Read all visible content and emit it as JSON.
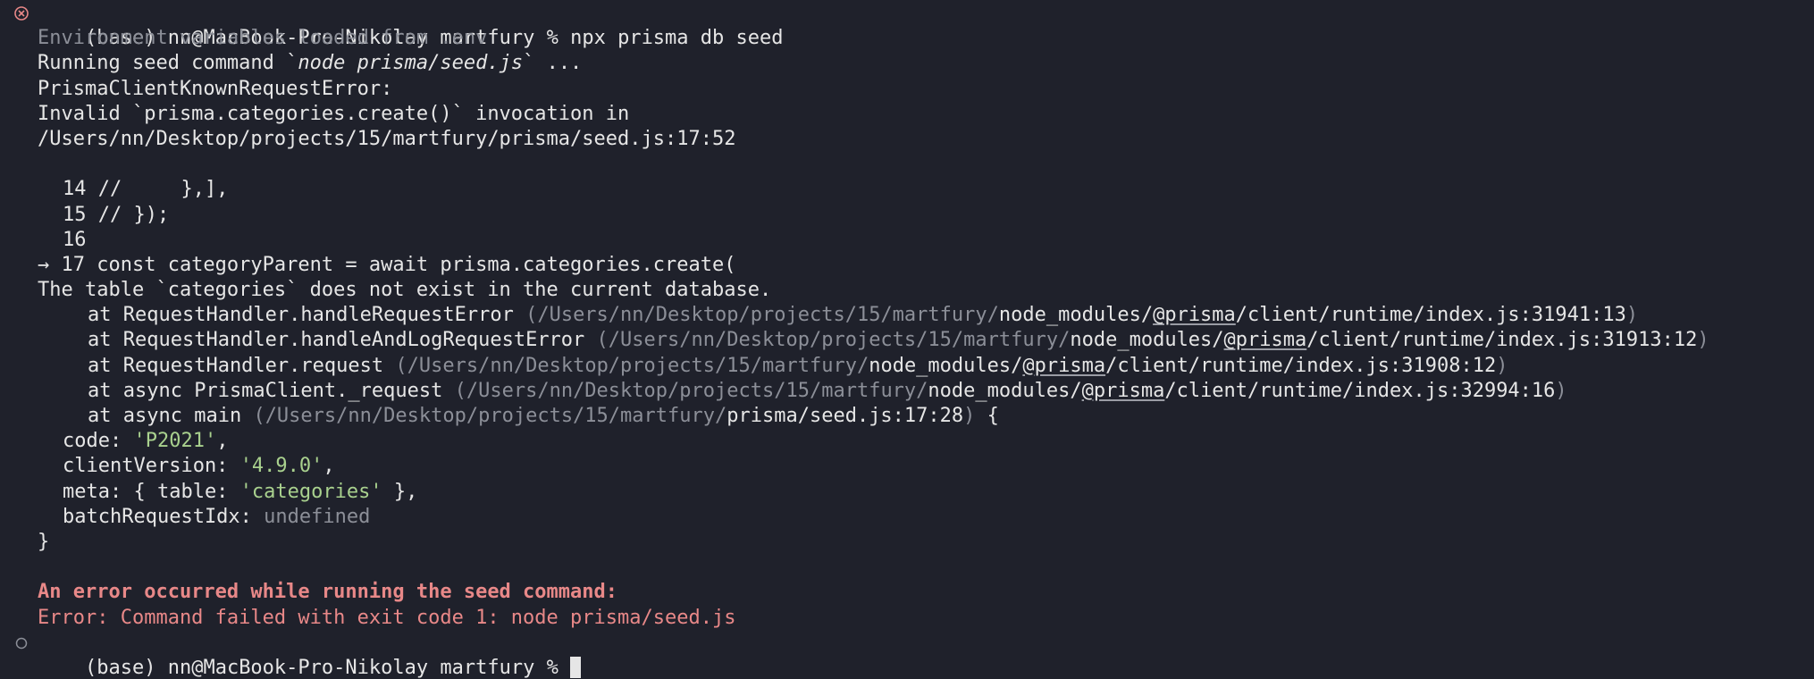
{
  "colors": {
    "background": "#1f212b",
    "text": "#e6e6e6",
    "dim": "#8c8f98",
    "string": "#a9d18e",
    "error": "#e88888"
  },
  "prompt": {
    "env": "(base)",
    "host": "nn@MacBook-Pro-Nikolay",
    "dir": "martfury",
    "symbol": "%",
    "command": "npx prisma db seed",
    "status_icon": "error-circle-icon",
    "idle_icon": "hollow-circle-icon"
  },
  "output": {
    "env_loaded": "Environment variables loaded from .env",
    "running_prefix": "Running seed command `",
    "running_cmd": "node prisma/seed.js",
    "running_suffix": "` ...",
    "error_class": "PrismaClientKnownRequestError:",
    "invalid_line": "Invalid `prisma.categories.create()` invocation in",
    "file_location": "/Users/nn/Desktop/projects/15/martfury/prisma/seed.js:17:52",
    "code_lines": [
      "14 //     },],",
      "15 // });",
      "16",
      "→ 17 const categoryParent = await prisma.categories.create("
    ],
    "table_error": "The table `categories` does not exist in the current database.",
    "stack": [
      {
        "at": "at RequestHandler.handleRequestError",
        "path": "/Users/nn/Desktop/projects/15/martfury/",
        "mod": "node_modules/",
        "scope": "@prisma",
        "rest": "/client/runtime/index.js:31941:13",
        "suffix": ""
      },
      {
        "at": "at RequestHandler.handleAndLogRequestError",
        "path": "/Users/nn/Desktop/projects/15/martfury/",
        "mod": "node_modules/",
        "scope": "@prisma",
        "rest": "/client/runtime/index.js:31913:12",
        "suffix": ""
      },
      {
        "at": "at RequestHandler.request",
        "path": "/Users/nn/Desktop/projects/15/martfury/",
        "mod": "node_modules/",
        "scope": "@prisma",
        "rest": "/client/runtime/index.js:31908:12",
        "suffix": ""
      },
      {
        "at": "at async PrismaClient._request",
        "path": "/Users/nn/Desktop/projects/15/martfury/",
        "mod": "node_modules/",
        "scope": "@prisma",
        "rest": "/client/runtime/index.js:32994:16",
        "suffix": ""
      },
      {
        "at": "at async main",
        "path": "/Users/nn/Desktop/projects/15/martfury/",
        "mod": "prisma/seed.js:17:28",
        "scope": "",
        "rest": "",
        "suffix": " {"
      }
    ],
    "props": {
      "code_key": "code:",
      "code_val": "'P2021'",
      "client_key": "clientVersion:",
      "client_val": "'4.9.0'",
      "meta_key": "meta: { table:",
      "meta_val": "'categories'",
      "meta_end": " },",
      "batch_key": "batchRequestIdx:",
      "batch_val": "undefined",
      "close": "}"
    },
    "seed_error_title": "An error occurred while running the seed command:",
    "seed_error_detail": "Error: Command failed with exit code 1: node prisma/seed.js"
  }
}
